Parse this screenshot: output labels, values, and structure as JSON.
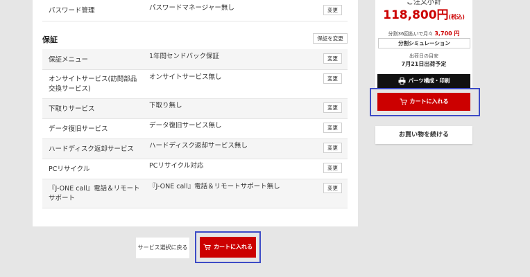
{
  "top_row": {
    "label": "パスワード管理",
    "value": "パスワードマネージャー無し",
    "change": "変更"
  },
  "warranty": {
    "title": "保証",
    "change_all": "保証を変更",
    "rows": [
      {
        "label": "保証メニュー",
        "value": "1年間センドバック保証",
        "change": "変更"
      },
      {
        "label": "オンサイトサービス(訪問部品交換サービス)",
        "value": "オンサイトサービス無し",
        "change": "変更"
      },
      {
        "label": "下取りサービス",
        "value": "下取り無し",
        "change": "変更"
      },
      {
        "label": "データ復旧サービス",
        "value": "データ復旧サービス無し",
        "change": "変更"
      },
      {
        "label": "ハードディスク返却サービス",
        "value": "ハードディスク返却サービス無し",
        "change": "変更"
      },
      {
        "label": "PCリサイクル",
        "value": "PCリサイクル対応",
        "change": "変更"
      },
      {
        "label": "『J-ONE call』電話＆リモートサポート",
        "value": "『J-ONE call』電話＆リモートサポート無し",
        "change": "変更"
      }
    ]
  },
  "bottom": {
    "back": "サービス選択に戻る",
    "add_cart": "カートに入れる"
  },
  "sidebar": {
    "total_label": "ご注文小計",
    "price": "118,800円",
    "tax": "(税込)",
    "split_text": "分割36回払いで月々",
    "split_amount": "3,700 円",
    "simulation": "分割シミュレーション",
    "ship_label": "出荷日の目安",
    "ship_date": "7月21日出荷予定",
    "parts": "パーツ構成・印刷",
    "add_cart": "カートに入れる",
    "continue": "お買い物を続ける"
  },
  "colors": {
    "accent_red": "#cc0000",
    "highlight_blue": "#3d4bc6"
  }
}
